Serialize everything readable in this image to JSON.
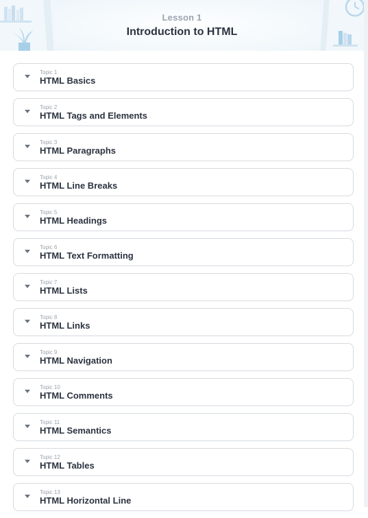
{
  "header": {
    "lesson_label": "Lesson 1",
    "lesson_title": "Introduction to HTML"
  },
  "colors": {
    "header_bg": "#f1f7fb",
    "title_text": "#2b3340",
    "muted_text": "#9aa5af",
    "card_border": "#d6dadf",
    "accent_blue": "#a9cfe8"
  },
  "topics": [
    {
      "number": "Topic 1",
      "name": "HTML Basics"
    },
    {
      "number": "Topic 2",
      "name": "HTML Tags and Elements"
    },
    {
      "number": "Topic 3",
      "name": "HTML Paragraphs"
    },
    {
      "number": "Topic 4",
      "name": "HTML Line Breaks"
    },
    {
      "number": "Topic 5",
      "name": "HTML Headings"
    },
    {
      "number": "Topic 6",
      "name": "HTML Text Formatting"
    },
    {
      "number": "Topic 7",
      "name": "HTML Lists"
    },
    {
      "number": "Topic 8",
      "name": "HTML Links"
    },
    {
      "number": "Topic 9",
      "name": "HTML Navigation"
    },
    {
      "number": "Topic 10",
      "name": "HTML Comments"
    },
    {
      "number": "Topic 11",
      "name": "HTML Semantics"
    },
    {
      "number": "Topic 12",
      "name": "HTML Tables"
    },
    {
      "number": "Topic 13",
      "name": "HTML Horizontal Line"
    }
  ]
}
